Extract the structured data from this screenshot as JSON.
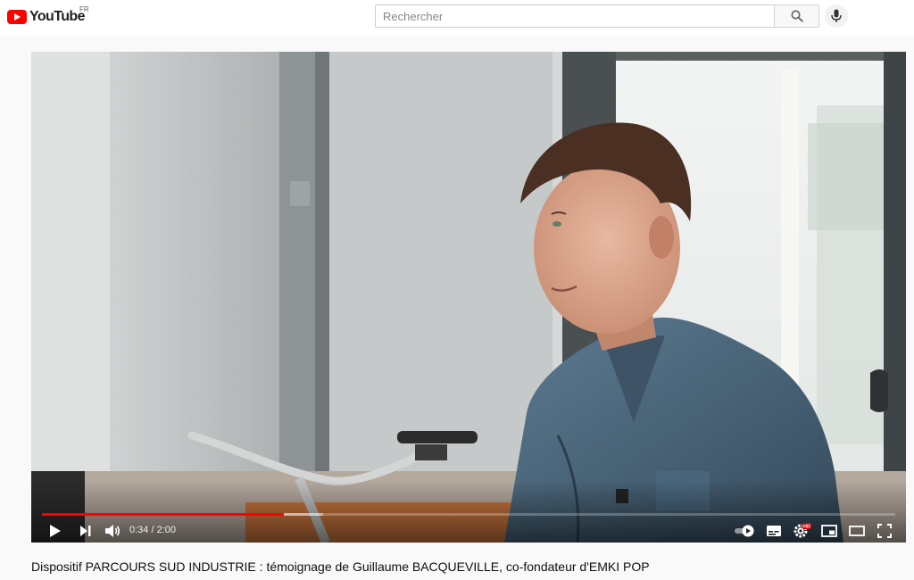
{
  "header": {
    "logo_text": "YouTube",
    "country_code": "FR",
    "search": {
      "placeholder": "Rechercher",
      "value": ""
    }
  },
  "icons": {
    "logo": "youtube-logo-icon",
    "search": "search-icon",
    "mic": "microphone-icon",
    "play": "play-icon",
    "next": "next-icon",
    "volume": "volume-icon",
    "autoplay": "autoplay-toggle-icon",
    "subtitles": "subtitles-icon",
    "settings": "gear-icon",
    "miniplayer": "miniplayer-icon",
    "theater": "theater-mode-icon",
    "fullscreen": "fullscreen-icon"
  },
  "player": {
    "current_time": "0:34",
    "duration": "2:00",
    "progress_fraction": 0.283,
    "buffered_fraction": 0.33,
    "settings_badge": "HD"
  },
  "video": {
    "title": "Dispositif PARCOURS SUD INDUSTRIE : témoignage de Guillaume BACQUEVILLE, co-fondateur d'EMKI POP"
  },
  "colors": {
    "brand_red": "#ff0000",
    "progress_red": "#ff0000",
    "hd_badge": "#cc0000"
  }
}
